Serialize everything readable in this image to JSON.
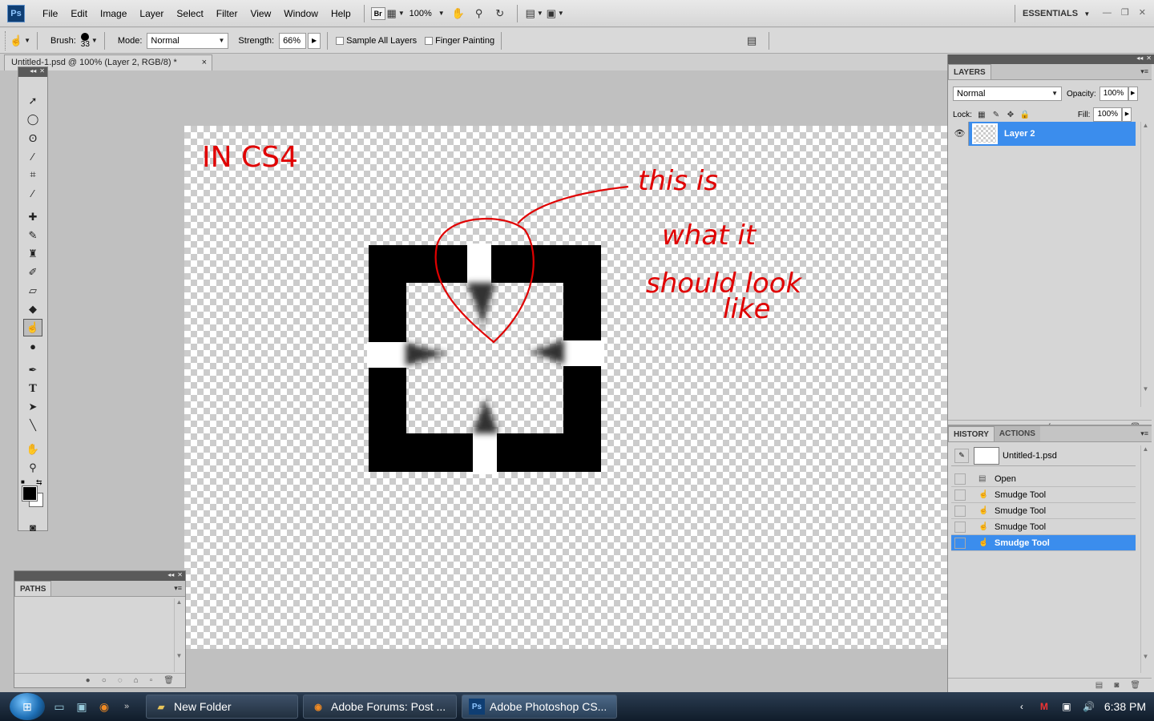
{
  "app": {
    "logo": "Ps"
  },
  "menu": [
    "File",
    "Edit",
    "Image",
    "Layer",
    "Select",
    "Filter",
    "View",
    "Window",
    "Help"
  ],
  "appbar": {
    "bridge_label": "Br",
    "zoom": "100%",
    "workspace": "ESSENTIALS"
  },
  "options": {
    "brush_label": "Brush:",
    "brush_size": "33",
    "mode_label": "Mode:",
    "mode_value": "Normal",
    "strength_label": "Strength:",
    "strength_value": "66%",
    "sample_all_layers": "Sample All Layers",
    "finger_painting": "Finger Painting"
  },
  "document": {
    "tab_title": "Untitled-1.psd @ 100% (Layer 2, RGB/8) *",
    "close_glyph": "×"
  },
  "annotations": {
    "title": "IN CS4",
    "note_line1": "this is",
    "note_line2": "what it",
    "note_line3": "should look",
    "note_line4": "like",
    "ink_color": "#e00000"
  },
  "paths_panel": {
    "tab": "PATHS"
  },
  "layers_panel": {
    "tab": "LAYERS",
    "blend_mode": "Normal",
    "opacity_label": "Opacity:",
    "opacity_value": "100%",
    "lock_label": "Lock:",
    "fill_label": "Fill:",
    "fill_value": "100%",
    "layers": [
      {
        "name": "Layer 2",
        "visible": true,
        "selected": true
      }
    ]
  },
  "history_panel": {
    "tabs": [
      "HISTORY",
      "ACTIONS"
    ],
    "snapshot": "Untitled-1.psd",
    "states": [
      {
        "label": "Open",
        "icon": "open-icon",
        "active": false
      },
      {
        "label": "Smudge Tool",
        "icon": "smudge-icon",
        "active": false
      },
      {
        "label": "Smudge Tool",
        "icon": "smudge-icon",
        "active": false
      },
      {
        "label": "Smudge Tool",
        "icon": "smudge-icon",
        "active": false
      },
      {
        "label": "Smudge Tool",
        "icon": "smudge-icon",
        "active": true
      }
    ]
  },
  "taskbar": {
    "buttons": [
      {
        "label": "New Folder",
        "icon": "folder-icon"
      },
      {
        "label": "Adobe Forums: Post ...",
        "icon": "firefox-icon"
      },
      {
        "label": "Adobe Photoshop CS...",
        "icon": "photoshop-icon"
      }
    ],
    "clock": "6:38 PM"
  },
  "colors": {
    "selection": "#3b8ded",
    "foreground": "#000000",
    "background": "#ffffff"
  }
}
